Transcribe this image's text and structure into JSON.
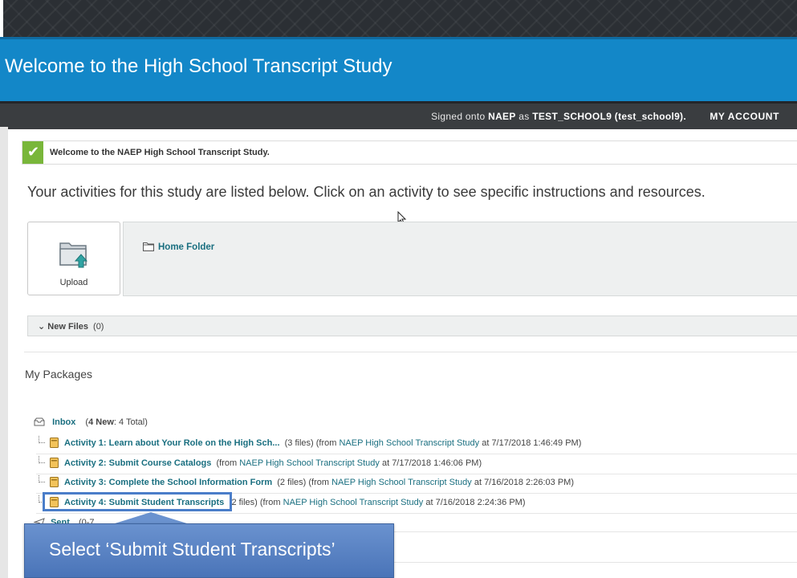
{
  "banner": {
    "title": "Welcome to the High School Transcript Study"
  },
  "account_bar": {
    "signed_prefix": "Signed onto ",
    "org": "NAEP",
    "as_text": " as ",
    "user": "TEST_SCHOOL9",
    "user_paren": " (test_school9).",
    "my_account": "MY ACCOUNT"
  },
  "alert": {
    "message": "Welcome to the NAEP High School Transcript Study."
  },
  "instructions": "Your activities for this study are listed below. Click on an activity to see specific instructions and resources.",
  "upload": {
    "label": "Upload"
  },
  "folder": {
    "home": "Home Folder"
  },
  "new_files": {
    "label": "New Files",
    "count": "(0)"
  },
  "packages": {
    "heading": "My Packages",
    "inbox": {
      "label": "Inbox",
      "new_count": "4 New",
      "total": ": 4 Total)",
      "open_paren": "("
    },
    "rows": [
      {
        "title": "Activity 1: Learn about Your Role on the High Sch...",
        "files": "(3 files) (from ",
        "from": "NAEP High School Transcript Study",
        "date": " at 7/17/2018 1:46:49 PM)"
      },
      {
        "title": "Activity 2: Submit Course Catalogs",
        "files": "(from ",
        "from": "NAEP High School Transcript Study",
        "date": " at 7/17/2018 1:46:06 PM)"
      },
      {
        "title": "Activity 3: Complete the School Information Form",
        "files": "(2 files) (from ",
        "from": "NAEP High School Transcript Study",
        "date": " at 7/16/2018 2:26:03 PM)"
      },
      {
        "title": "Activity 4: Submit Student Transcripts",
        "files": "2 files) (from ",
        "from": "NAEP High School Transcript Study",
        "date": " at 7/16/2018 2:24:36 PM)"
      }
    ],
    "sent": {
      "label": "Sent",
      "count": "(0-7"
    }
  },
  "callout": {
    "text": "Select ‘Submit Student Transcripts’"
  },
  "colors": {
    "banner": "#1387c8",
    "accent_teal": "#1a6f80",
    "success": "#79b63a",
    "callout": "#5a82c2"
  },
  "icons": [
    "check-icon",
    "upload-folder-icon",
    "folder-icon",
    "chevron-down-icon",
    "inbox-icon",
    "package-icon",
    "sent-icon",
    "mouse-cursor-icon"
  ]
}
